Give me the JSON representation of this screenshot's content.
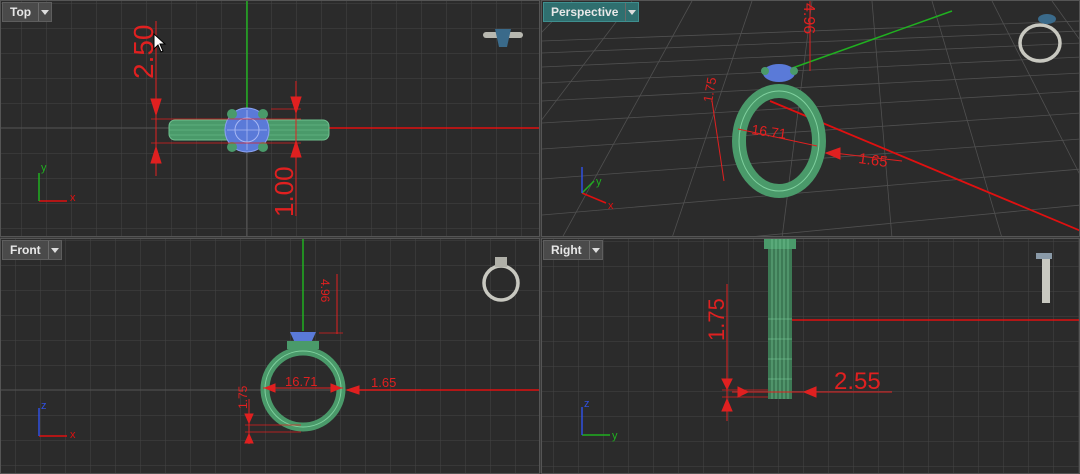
{
  "viewports": {
    "top": {
      "title": "Top"
    },
    "perspective": {
      "title": "Perspective"
    },
    "front": {
      "title": "Front"
    },
    "right": {
      "title": "Right"
    }
  },
  "dimensions": {
    "top": {
      "d1": "2.50",
      "d2": "1.00"
    },
    "perspective": {
      "d1": "4.96",
      "d2": "1.75",
      "d3": "16.71",
      "d4": "1.65"
    },
    "front": {
      "d1": "4.96",
      "d2": "16.71",
      "d3": "1.65",
      "d4": "1.75"
    },
    "right": {
      "d1": "1.75",
      "d2": "2.55"
    }
  },
  "axis_labels": {
    "x": "x",
    "y": "y",
    "z": "z"
  },
  "colors": {
    "x_axis": "#e01010",
    "y_axis": "#20b020",
    "dimension": "#e02020",
    "ring": "#4a9a6a",
    "gem": "#4a6ad0",
    "active_title": "#2f6f6f"
  }
}
